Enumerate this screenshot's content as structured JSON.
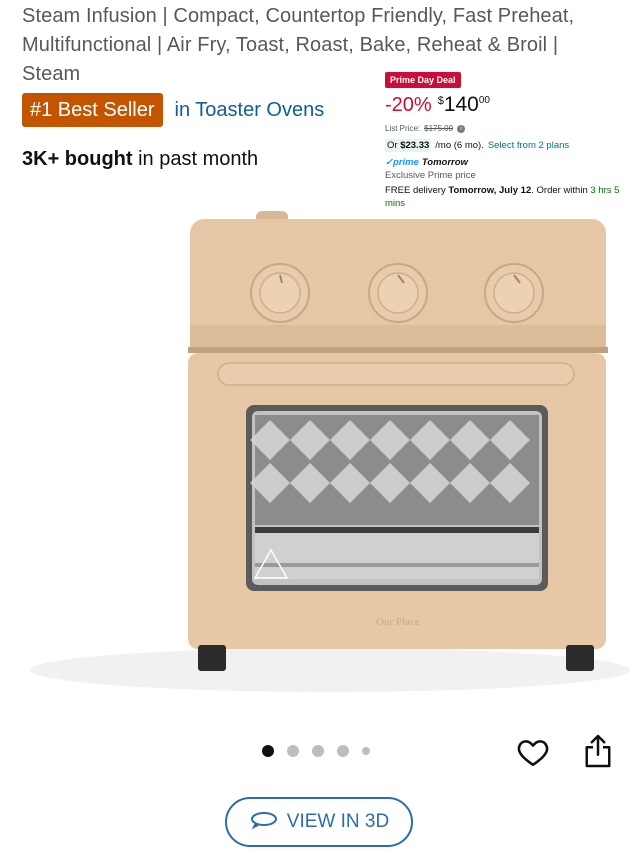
{
  "product": {
    "title": "Steam Infusion | Compact, Countertop Friendly, Fast Preheat, Multifunctional | Air Fry, Toast, Roast, Bake, Reheat & Broil | Steam",
    "badge": "#1 Best Seller",
    "badge_category": "in Toaster Ovens",
    "bought_count": "3K+ bought",
    "bought_suffix": " in past month"
  },
  "deal": {
    "tag": "Prime Day Deal",
    "discount": "-20%",
    "currency": "$",
    "price_whole": "140",
    "price_cents": "00",
    "list_price_label": "List Price:",
    "list_price": "$175.00",
    "info_icon": "info-icon",
    "monthly_prefix": "Or",
    "monthly_amount": "$23.33",
    "monthly_suffix": "/mo (6 mo).",
    "plans_link": "Select from 2 plans",
    "prime_logo": "prime",
    "prime_label": "Tomorrow",
    "exclusive": "Exclusive Prime price",
    "delivery_prefix": "FREE delivery",
    "delivery_date": "Tomorrow, July 12",
    "delivery_middle": ". Order within",
    "delivery_countdown": "3 hrs 5 mins"
  },
  "gallery": {
    "image_count": 5,
    "active_index": 0,
    "brand_mark": "Our Place"
  },
  "actions": {
    "wishlist_icon": "heart-icon",
    "share_icon": "share-icon",
    "view3d_icon": "rotate-3d-icon",
    "view3d_label": "VIEW IN 3D"
  },
  "colors": {
    "badge": "#c45500",
    "deal_red": "#cc0c39",
    "link_blue": "#0f5f92",
    "oven": "#e3c5a4"
  }
}
